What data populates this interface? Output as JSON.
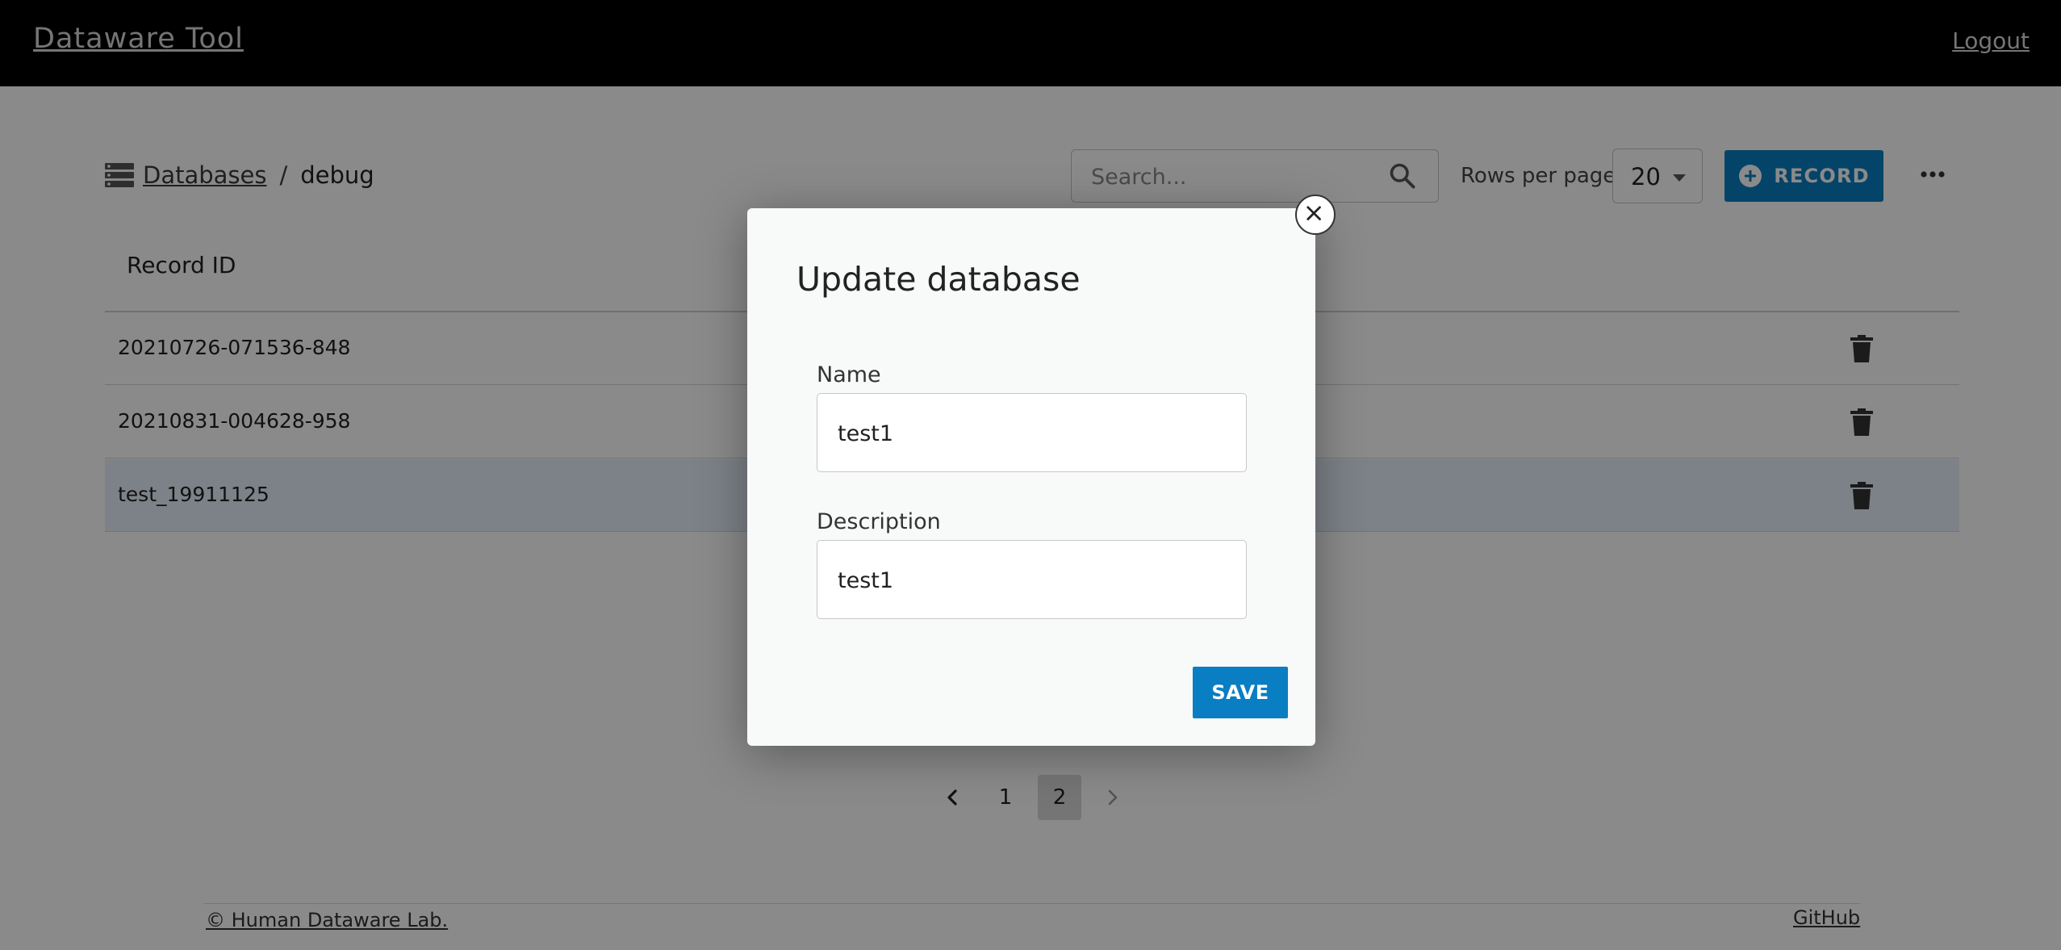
{
  "app": {
    "title": "Dataware Tool",
    "logout_label": "Logout"
  },
  "breadcrumb": {
    "root_label": "Databases",
    "separator": "/",
    "current": "debug"
  },
  "toolbar": {
    "search_placeholder": "Search...",
    "rows_per_page_label": "Rows per page",
    "rows_per_page_value": "20",
    "add_record_label": "RECORD"
  },
  "table": {
    "columns": [
      "Record ID"
    ],
    "rows": [
      {
        "id": "20210726-071536-848"
      },
      {
        "id": "20210831-004628-958"
      },
      {
        "id": "test_19911125",
        "highlighted": true
      }
    ]
  },
  "pagination": {
    "pages": [
      "1",
      "2"
    ],
    "current": "2"
  },
  "footer": {
    "copyright": "© Human Dataware Lab.",
    "github": "GitHub"
  },
  "modal": {
    "title": "Update database",
    "name_label": "Name",
    "name_value": "test1",
    "description_label": "Description",
    "description_value": "test1",
    "save_label": "SAVE"
  },
  "colors": {
    "primary": "#0a7ec2",
    "topbar": "#000000",
    "highlight_row": "#e7f1fb"
  }
}
